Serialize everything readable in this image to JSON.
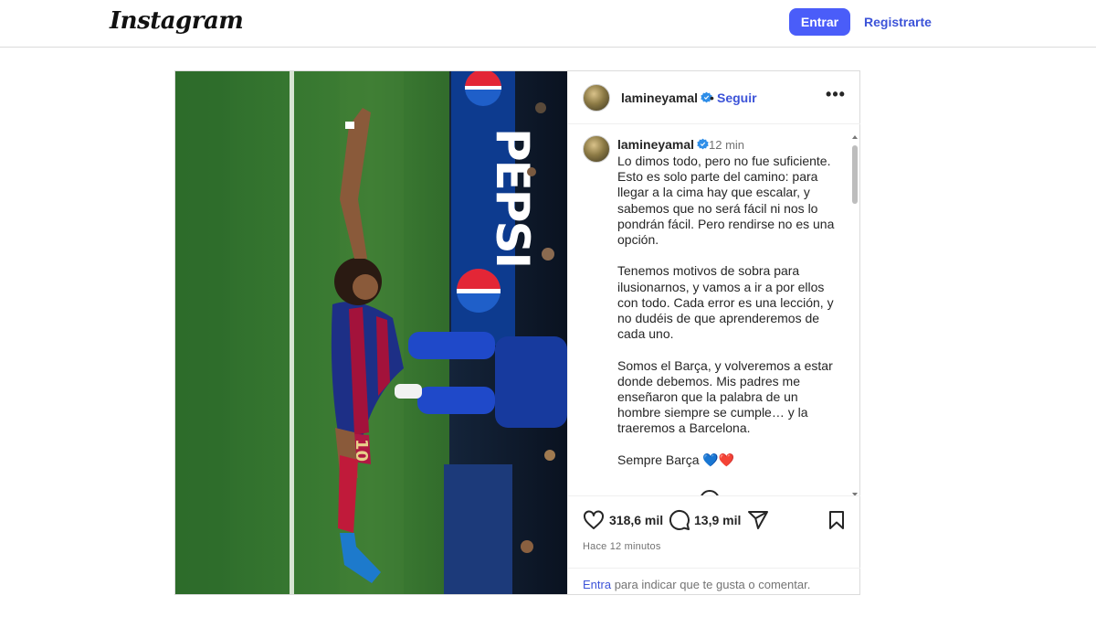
{
  "brand": {
    "logo_text": "Instagram"
  },
  "nav": {
    "login_label": "Entrar",
    "register_label": "Registrarte",
    "accent": "#4a5df9"
  },
  "post": {
    "username": "lamineyamal",
    "follow_separator": "•",
    "follow_label": "Seguir",
    "more_label": "•••",
    "caption": {
      "username": "lamineyamal",
      "time": "12 min",
      "text": "Lo dimos todo, pero no fue suficiente. Esto es solo parte del camino: para llegar a la cima hay que escalar, y sabemos que no será fácil ni nos lo pondrán fácil. Pero rendirse no es una opción.\n\nTenemos motivos de sobra para ilusionarnos, y vamos a ir a por ellos con todo. Cada error es una lección, y no dudéis de que aprenderemos de cada uno.\n\nSomos el Barça, y volveremos a estar donde debemos. Mis padres me enseñaron que la palabra de un hombre siempre se cumple… y la traeremos a Barcelona.\n\nSempre Barça 💙❤️"
    },
    "likes": "318,6 mil",
    "comments": "13,9 mil",
    "timestamp": "Hace 12 minutos",
    "login_prompt_link": "Entra",
    "login_prompt_rest": " para indicar que te gusta o comentar.",
    "image": {
      "banner_text": "PEPSI",
      "shirt_number": "10"
    }
  },
  "icons": [
    "verified-badge-icon",
    "more-options-icon",
    "heart-icon",
    "comment-icon",
    "share-icon",
    "bookmark-icon"
  ]
}
